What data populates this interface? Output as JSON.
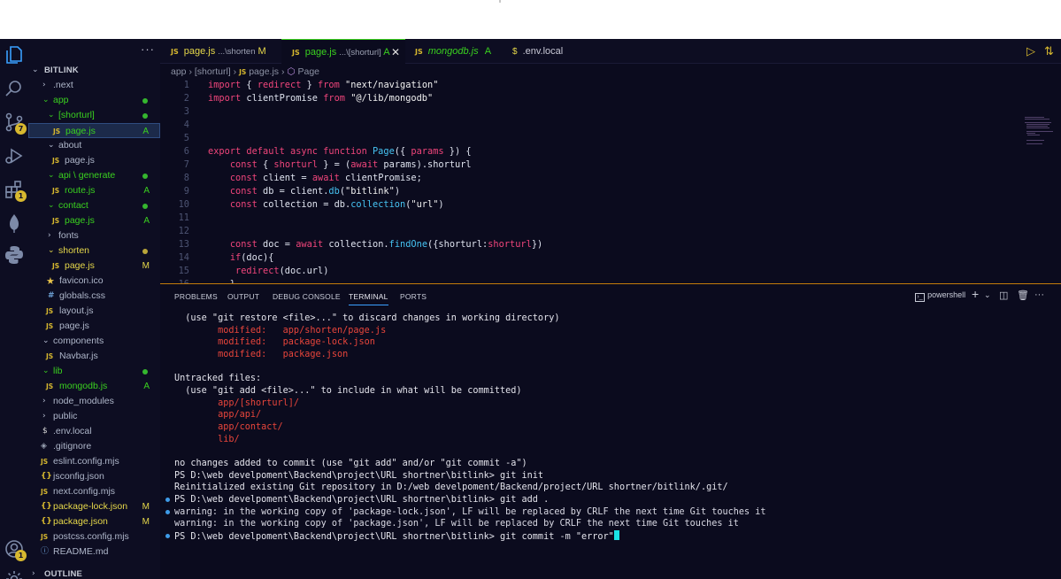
{
  "tabs": [
    {
      "name": "page.js",
      "path": "...\\shorten",
      "status": "M"
    },
    {
      "name": "page.js",
      "path": "...\\[shorturl]",
      "status": "A"
    },
    {
      "name": "mongodb.js",
      "path": "",
      "status": "A"
    },
    {
      "name": ".env.local",
      "path": "",
      "status": ""
    }
  ],
  "breadcrumb": [
    "app",
    "[shorturl]",
    "page.js",
    "Page"
  ],
  "sidebar": {
    "more": "···",
    "project": "BITLINK",
    "items": [
      {
        "label": ".next"
      },
      {
        "label": "app"
      },
      {
        "label": "[shorturl]"
      },
      {
        "label": "page.js",
        "status": "A"
      },
      {
        "label": "about"
      },
      {
        "label": "page.js"
      },
      {
        "label": "api \\ generate"
      },
      {
        "label": "route.js",
        "status": "A"
      },
      {
        "label": "contact"
      },
      {
        "label": "page.js",
        "status": "A"
      },
      {
        "label": "fonts"
      },
      {
        "label": "shorten"
      },
      {
        "label": "page.js",
        "status": "M"
      },
      {
        "label": "favicon.ico"
      },
      {
        "label": "globals.css"
      },
      {
        "label": "layout.js"
      },
      {
        "label": "page.js"
      },
      {
        "label": "components"
      },
      {
        "label": "Navbar.js"
      },
      {
        "label": "lib"
      },
      {
        "label": "mongodb.js",
        "status": "A"
      },
      {
        "label": "node_modules"
      },
      {
        "label": "public"
      },
      {
        "label": ".env.local"
      },
      {
        "label": ".gitignore"
      },
      {
        "label": "eslint.config.mjs"
      },
      {
        "label": "jsconfig.json"
      },
      {
        "label": "next.config.mjs"
      },
      {
        "label": "package-lock.json",
        "status": "M"
      },
      {
        "label": "package.json",
        "status": "M"
      },
      {
        "label": "postcss.config.mjs"
      },
      {
        "label": "README.md"
      }
    ],
    "outline": "OUTLINE"
  },
  "activity_badges": {
    "source_control": "7",
    "extensions": "1",
    "accounts": "1"
  },
  "editor": {
    "line_numbers": [
      "1",
      "2",
      "3",
      "4",
      "5",
      "6",
      "7",
      "8",
      "9",
      "10",
      "11",
      "12",
      "13",
      "14",
      "15",
      "16"
    ]
  },
  "panel": {
    "tabs": [
      "PROBLEMS",
      "OUTPUT",
      "DEBUG CONSOLE",
      "TERMINAL",
      "PORTS"
    ],
    "shell": "powershell",
    "terminal_lines": [
      "  (use \"git restore <file>...\" to discard changes in working directory)",
      "        modified:   app/shorten/page.js",
      "        modified:   package-lock.json",
      "        modified:   package.json",
      "",
      "Untracked files:",
      "  (use \"git add <file>...\" to include in what will be committed)",
      "        app/[shorturl]/",
      "        app/api/",
      "        app/contact/",
      "        lib/",
      "",
      "no changes added to commit (use \"git add\" and/or \"git commit -a\")",
      "PS D:\\web develpoment\\Backend\\project\\URL shortner\\bitlink> git init",
      "Reinitialized existing Git repository in D:/web develpoment/Backend/project/URL shortner/bitlink/.git/",
      "PS D:\\web develpoment\\Backend\\project\\URL shortner\\bitlink> git add .",
      "warning: in the working copy of 'package-lock.json', LF will be replaced by CRLF the next time Git touches it",
      "warning: in the working copy of 'package.json', LF will be replaced by CRLF the next time Git touches it",
      "PS D:\\web develpoment\\Backend\\project\\URL shortner\\bitlink> git commit -m \"error\""
    ]
  },
  "colors": {
    "accent": "#3ad11f",
    "keyword": "#f0457b",
    "function": "#46c3f2",
    "warning": "#d7b82f",
    "panel_border": "#c47c0a"
  }
}
